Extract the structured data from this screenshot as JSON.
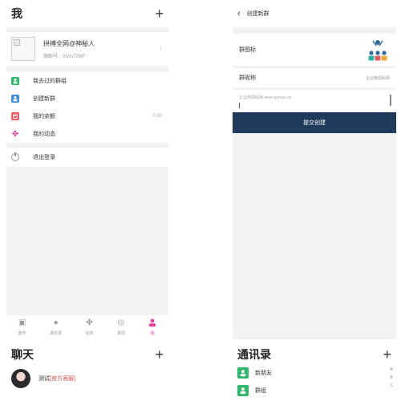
{
  "me": {
    "title": "我",
    "plus": "+",
    "profile": {
      "name": "拼搏全网@神秘人",
      "uid": "微聊号：XVm779rF",
      "chevron": "›"
    },
    "menu": [
      {
        "label": "我去过的群组",
        "icon": "group-icon"
      },
      {
        "label": "创建新群",
        "icon": "person-add-icon"
      },
      {
        "label": "我的余额",
        "icon": "wallet-icon",
        "value": "0.00"
      },
      {
        "label": "我的动态",
        "icon": "pinwheel-icon"
      }
    ],
    "logout": "退出登录",
    "tabs": [
      {
        "label": "聊天",
        "icon": "chat-icon"
      },
      {
        "label": "通讯录",
        "icon": "contacts-icon"
      },
      {
        "label": "动态",
        "icon": "pinwheel-icon"
      },
      {
        "label": "发现",
        "icon": "compass-icon"
      },
      {
        "label": "我",
        "icon": "user-icon",
        "active": true
      }
    ],
    "accent": "#e4409d"
  },
  "create_group": {
    "back": "‹",
    "title": "创建新群",
    "icon_label": "群图标",
    "name_label": "群昵称",
    "name_placeholder": "企业微源码网",
    "description": "企业微源码网-www.qymao.cn",
    "submit": "提交创建",
    "submit_color": "#1f3a5a"
  },
  "chat": {
    "title": "聊天",
    "plus": "+",
    "items": [
      {
        "name": "测试",
        "tag": "[官方客服]"
      }
    ]
  },
  "contacts": {
    "title": "通讯录",
    "plus": "+",
    "items": [
      {
        "label": "新朋友"
      },
      {
        "label": "群组"
      }
    ],
    "index": [
      "A",
      "B",
      "C"
    ]
  }
}
